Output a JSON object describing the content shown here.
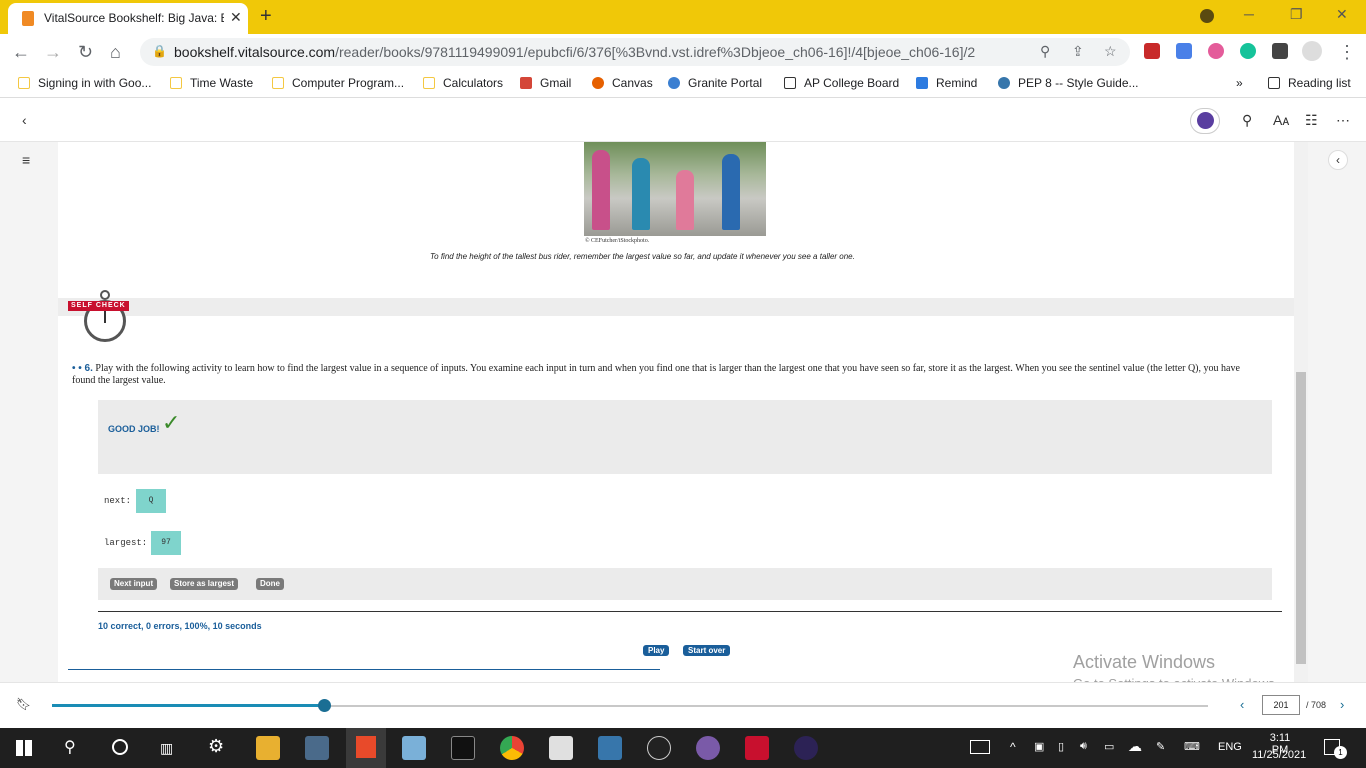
{
  "browser": {
    "tab_title": "VitalSource Bookshelf: Big Java: E",
    "close_glyph": "✕",
    "new_tab_glyph": "+",
    "url_host": "bookshelf.vitalsource.com",
    "url_path": "/reader/books/9781119499091/epubcfi/6/376[%3Bvnd.vst.idref%3Dbjeoe_ch06-16]!/4[bjeoe_ch06-16]/2",
    "window_controls": [
      "─",
      "❐",
      "✕"
    ]
  },
  "bookmarks": [
    {
      "label": "Signing in with Goo...",
      "color": "#f4c842"
    },
    {
      "label": "Time Waste",
      "color": "#f4c842"
    },
    {
      "label": "Computer Program...",
      "color": "#f4c842"
    },
    {
      "label": "Calculators",
      "color": "#f4c842"
    },
    {
      "label": "Gmail",
      "color": "#d44638"
    },
    {
      "label": "Canvas",
      "color": "#e66000"
    },
    {
      "label": "Granite Portal",
      "color": "#3b7fd1"
    },
    {
      "label": "AP College Board",
      "color": "#333333"
    },
    {
      "label": "Remind",
      "color": "#2d7be0"
    },
    {
      "label": "PEP 8 -- Style Guide...",
      "color": "#3776ab"
    }
  ],
  "bookmarks_overflow": "»",
  "reading_list": "Reading list",
  "figure": {
    "credit": "© CEFutcher/iStockphoto.",
    "caption": "To find the height of the tallest bus rider, remember the largest value so far, and update it whenever you see a taller one."
  },
  "self_check": {
    "label": "SELF CHECK"
  },
  "question": {
    "number": "• • 6.",
    "text": "Play with the following activity to learn how to find the largest value in a sequence of inputs. You examine each input in turn and when you find one that is larger than the largest one that you have seen so far, store it as the largest. When you see the sentinel value (the letter Q), you have found the largest value."
  },
  "activity": {
    "feedback": "GOOD JOB!",
    "check_glyph": "✓",
    "next_label": "next:",
    "next_value": "Q",
    "largest_label": "largest:",
    "largest_value": "97",
    "buttons": [
      "Next input",
      "Store as largest",
      "Done"
    ],
    "score": "10 correct, 0 errors, 100%, 10 seconds",
    "play": "Play",
    "start_over": "Start over"
  },
  "watermark": {
    "line1": "Activate Windows",
    "line2": "Go to Settings to activate Windows."
  },
  "footer": {
    "page": "201",
    "total": "/ 708",
    "progress": 0.2356
  },
  "taskbar": {
    "language": "ENG",
    "time": "3:11 PM",
    "date": "11/25/2021",
    "notifications": "1"
  }
}
